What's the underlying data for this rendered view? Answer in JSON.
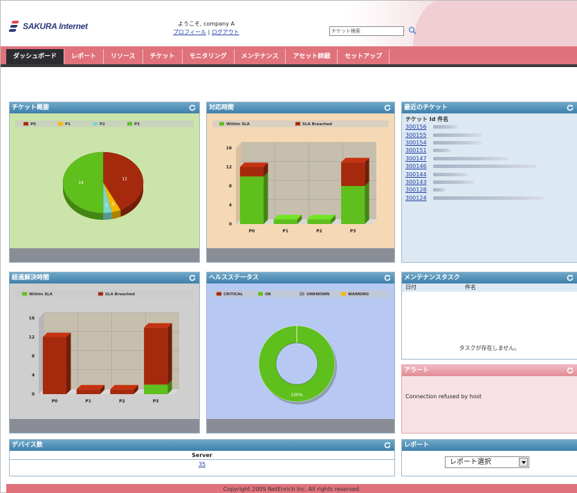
{
  "header": {
    "brand": "SAKURA Internet",
    "welcome": "ようこそ, company A",
    "profile_link": "プロフィール",
    "separator": "|",
    "logout_link": "ログアウト",
    "search_placeholder": "チケット検索"
  },
  "nav": {
    "items": [
      "ダッシュボード",
      "レポート",
      "リソース",
      "チケット",
      "モニタリング",
      "メンテナンス",
      "アセット詳細",
      "セットアップ"
    ],
    "active_index": 0,
    "colors": {
      "bar": "#e0727c",
      "active": "#2c2c30"
    }
  },
  "panels": {
    "ticket_summary": {
      "title": "チケット概要",
      "chart_data": {
        "type": "pie",
        "categories": [
          "P0",
          "P1",
          "P2",
          "P3"
        ],
        "values": [
          12,
          1,
          1,
          14
        ],
        "colors": [
          "#a52a0d",
          "#f5b800",
          "#7ed6c7",
          "#5fbf1d"
        ],
        "slice_labels": [
          "12",
          "1",
          "1",
          "14"
        ],
        "legend_position": "top"
      }
    },
    "response_time": {
      "title": "対応時間",
      "chart_data": {
        "type": "bar",
        "stacked": true,
        "categories": [
          "P0",
          "P1",
          "P2",
          "P3"
        ],
        "series": [
          {
            "name": "Within SLA",
            "values": [
              10,
              1,
              1,
              8
            ],
            "color": "#5fbf1d"
          },
          {
            "name": "SLA Breached",
            "values": [
              2,
              0,
              0,
              5
            ],
            "color": "#a52a0d"
          }
        ],
        "y_ticks": [
          "0",
          "4",
          "8",
          "12",
          "16"
        ],
        "ylim": [
          0,
          16
        ],
        "legend_position": "top"
      }
    },
    "recent_tickets": {
      "title": "最近のチケット",
      "columns": [
        "チケット Id",
        "件名"
      ],
      "ids": [
        "300156",
        "300155",
        "300154",
        "300151",
        "300147",
        "300146",
        "300144",
        "300143",
        "300128",
        "300124"
      ]
    },
    "resolution_time": {
      "title": "経過解決時間",
      "chart_data": {
        "type": "bar",
        "stacked": true,
        "categories": [
          "P0",
          "P1",
          "P2",
          "P3"
        ],
        "series": [
          {
            "name": "Within SLA",
            "values": [
              0,
              0,
              0,
              2
            ],
            "color": "#5fbf1d"
          },
          {
            "name": "SLA Breached",
            "values": [
              12,
              1,
              1,
              12
            ],
            "color": "#a52a0d"
          }
        ],
        "y_ticks": [
          "0",
          "4",
          "8",
          "12",
          "16"
        ],
        "ylim": [
          0,
          16
        ],
        "legend_position": "top"
      }
    },
    "health_status": {
      "title": "ヘルスステータス",
      "chart_data": {
        "type": "pie",
        "donut": true,
        "categories": [
          "CRITICAL",
          "OK",
          "UNKNOWN",
          "WARNING"
        ],
        "values": [
          0,
          100,
          0,
          0
        ],
        "colors": [
          "#a52a0d",
          "#5fbf1d",
          "#8a8d96",
          "#f5b800"
        ],
        "center_label": "100%",
        "legend_position": "top"
      }
    },
    "maintenance": {
      "title": "メンテナンスタスク",
      "columns": [
        "日付",
        "件名"
      ],
      "empty_message": "タスクが存在しません。"
    },
    "alert": {
      "title": "アラート",
      "message": "Connection refused by host"
    },
    "device_count": {
      "title": "デバイス数",
      "column": "Server",
      "value": "35"
    },
    "report": {
      "title": "レポート",
      "select_value": "レポート選択"
    }
  },
  "footer": {
    "copyright": "Copyright 2009 NetEnrich Inc. All rights reserved."
  }
}
